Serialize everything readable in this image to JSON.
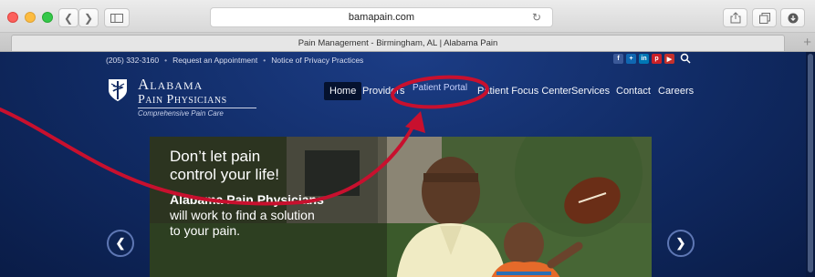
{
  "browser": {
    "url": "bamapain.com",
    "tab_title": "Pain Management - Birmingham, AL | Alabama Pain",
    "new_tab_symbol": "+"
  },
  "site": {
    "utility_bar": {
      "phone": "(205) 332-3160",
      "separator": "•",
      "request_appointment": "Request an Appointment",
      "privacy_notice": "Notice of Privacy Practices"
    },
    "social_icons": [
      {
        "name": "facebook-icon",
        "glyph": "f",
        "color": "#3b5998"
      },
      {
        "name": "google-plus-icon",
        "glyph": "+",
        "color": "#0f67b1"
      },
      {
        "name": "linkedin-icon",
        "glyph": "in",
        "color": "#0077b5"
      },
      {
        "name": "pinterest-icon",
        "glyph": "p",
        "color": "#cb2027"
      },
      {
        "name": "youtube-icon",
        "glyph": "▶",
        "color": "#c4302b"
      }
    ],
    "logo": {
      "line1": "Alabama",
      "line2": "Pain Physicians",
      "tagline": "Comprehensive Pain Care"
    },
    "nav": {
      "home": "Home",
      "providers": "Providers",
      "patient_portal": "Patient Portal",
      "patient_focus": "Patient Focus Center",
      "services": "Services",
      "contact": "Contact",
      "careers": "Careers"
    },
    "slide": {
      "headline_line1": "Don’t let pain",
      "headline_line2": "control your life!",
      "subhead": "Alabama Pain Physicians",
      "body_line1": "will work to find a solution",
      "body_line2": "to your pain."
    },
    "arrows": {
      "prev": "❮",
      "next": "❯"
    }
  },
  "colors": {
    "nav_bg": "#102a63",
    "annotation": "#c8102e"
  }
}
